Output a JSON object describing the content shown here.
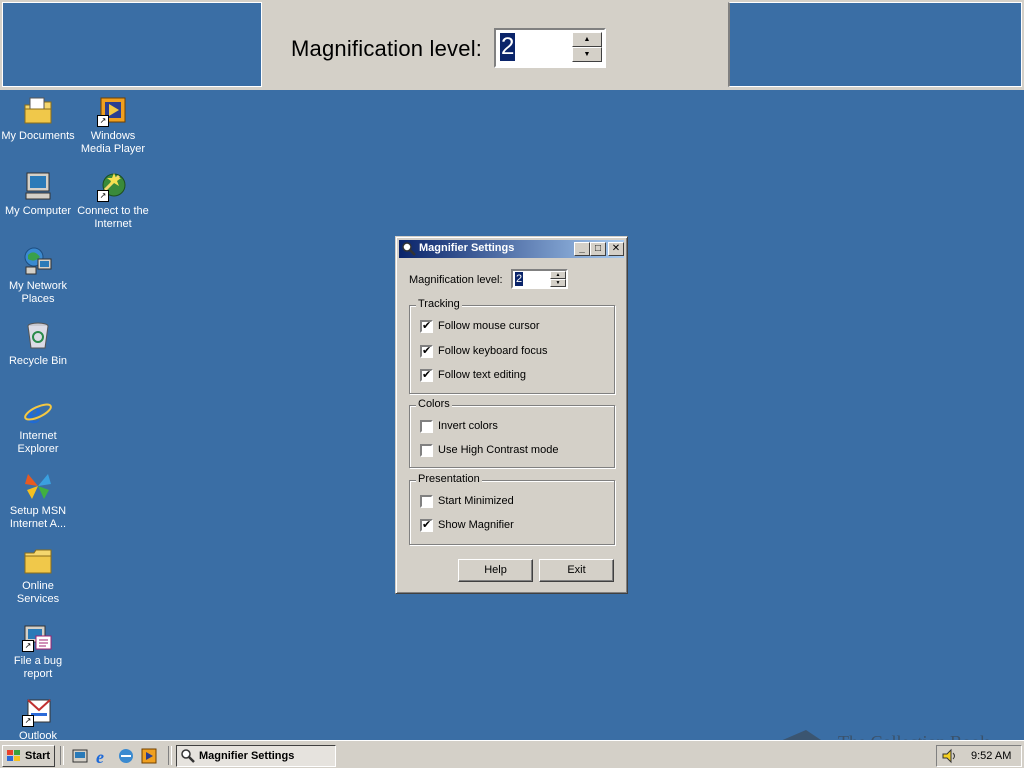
{
  "magnifier_strip": {
    "label": "Magnification level:",
    "value": "2"
  },
  "desktop_icons": [
    {
      "label": "My Documents"
    },
    {
      "label": "Windows Media Player"
    },
    {
      "label": "My Computer"
    },
    {
      "label": "Connect to the Internet"
    },
    {
      "label": "My Network Places"
    },
    {
      "label": "Recycle Bin"
    },
    {
      "label": "Internet Explorer"
    },
    {
      "label": "Setup MSN Internet A..."
    },
    {
      "label": "Online Services"
    },
    {
      "label": "File a bug report"
    },
    {
      "label": "Outlook"
    }
  ],
  "dialog": {
    "title": "Magnifier Settings",
    "mag_label": "Magnification level:",
    "mag_value": "2",
    "tracking": {
      "title": "Tracking",
      "items": [
        {
          "label": "Follow mouse cursor",
          "checked": "✔"
        },
        {
          "label": "Follow keyboard focus",
          "checked": "✔"
        },
        {
          "label": "Follow text editing",
          "checked": "✔"
        }
      ]
    },
    "colors": {
      "title": "Colors",
      "items": [
        {
          "label": "Invert colors",
          "checked": ""
        },
        {
          "label": "Use High Contrast mode",
          "checked": ""
        }
      ]
    },
    "presentation": {
      "title": "Presentation",
      "items": [
        {
          "label": "Start Minimized",
          "checked": ""
        },
        {
          "label": "Show Magnifier",
          "checked": "✔"
        }
      ]
    },
    "help_label": "Help",
    "exit_label": "Exit"
  },
  "taskbar": {
    "start_label": "Start",
    "task_label": "Magnifier Settings",
    "clock": "9:52 AM"
  },
  "watermark": "The Collection Book",
  "colors": {
    "desktop": "#3a6ea5",
    "titlebar": "#0a246a",
    "face": "#d4d0c8"
  }
}
